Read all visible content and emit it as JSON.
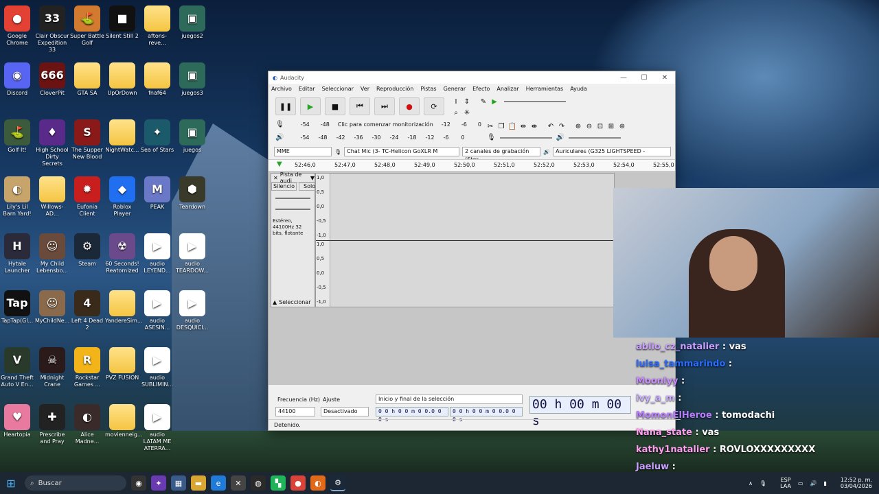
{
  "desktop": {
    "icons": [
      {
        "label": "Google Chrome",
        "color": "#e34133",
        "glyph": "●"
      },
      {
        "label": "Clair Obscur Expedition 33",
        "color": "#222",
        "glyph": "33"
      },
      {
        "label": "Super Battle Golf",
        "color": "#d27a2f",
        "glyph": "⛳"
      },
      {
        "label": "Silent Still 2",
        "color": "#111",
        "glyph": "■"
      },
      {
        "label": "aftons-reve...",
        "color": "folder",
        "glyph": ""
      },
      {
        "label": "juegos2",
        "color": "#2d6a5a",
        "glyph": "▣"
      },
      {
        "label": "Discord",
        "color": "#5865f2",
        "glyph": "◉"
      },
      {
        "label": "CloverPit",
        "color": "#6b1212",
        "glyph": "666"
      },
      {
        "label": "GTA SA",
        "color": "folder",
        "glyph": ""
      },
      {
        "label": "UpOrDown",
        "color": "folder",
        "glyph": ""
      },
      {
        "label": "fnaf64",
        "color": "folder",
        "glyph": ""
      },
      {
        "label": "juegos3",
        "color": "#2d6a5a",
        "glyph": "▣"
      },
      {
        "label": "Golf It!",
        "color": "#3c5a3c",
        "glyph": "⛳"
      },
      {
        "label": "High School Dirty Secrets",
        "color": "#5a2a8a",
        "glyph": "♦"
      },
      {
        "label": "The Supper New Blood",
        "color": "#8a1a1a",
        "glyph": "S"
      },
      {
        "label": "NightWatc...",
        "color": "folder",
        "glyph": ""
      },
      {
        "label": "Sea of Stars",
        "color": "#1a5a6a",
        "glyph": "✦"
      },
      {
        "label": "juegos",
        "color": "#2d6a5a",
        "glyph": "▣"
      },
      {
        "label": "Lily's Lil Barn Yard!",
        "color": "#c7a46a",
        "glyph": "◐"
      },
      {
        "label": "Willows-AD...",
        "color": "folder",
        "glyph": ""
      },
      {
        "label": "Eufonia Client",
        "color": "#c81e1e",
        "glyph": "✹"
      },
      {
        "label": "Roblox Player",
        "color": "#1f6ff0",
        "glyph": "◆"
      },
      {
        "label": "PEAK",
        "color": "#6a78c8",
        "glyph": "M"
      },
      {
        "label": "Teardown",
        "color": "#3a3a2a",
        "glyph": "⬢"
      },
      {
        "label": "Hytale Launcher",
        "color": "#2a2a3a",
        "glyph": "H"
      },
      {
        "label": "My Child Lebensbo...",
        "color": "#6a4a3a",
        "glyph": "☺"
      },
      {
        "label": "Steam",
        "color": "#1b2838",
        "glyph": "⚙"
      },
      {
        "label": "60 Seconds! Reatomized",
        "color": "#6a4a8a",
        "glyph": "☢"
      },
      {
        "label": "audio LEYEND...",
        "color": "media",
        "glyph": "▶"
      },
      {
        "label": "audio TEARDOW...",
        "color": "media",
        "glyph": "▶"
      },
      {
        "label": "TapTap(Gl...",
        "color": "#111",
        "glyph": "Tap"
      },
      {
        "label": "MyChildNe...",
        "color": "#8a6a4a",
        "glyph": "☺"
      },
      {
        "label": "Left 4 Dead 2",
        "color": "#3a2a1a",
        "glyph": "4"
      },
      {
        "label": "YandereSim...",
        "color": "folder",
        "glyph": ""
      },
      {
        "label": "audio ASESIN...",
        "color": "media",
        "glyph": "▶"
      },
      {
        "label": "audio DESQUICI...",
        "color": "media",
        "glyph": "▶"
      },
      {
        "label": "Grand Theft Auto V En...",
        "color": "#2a3a2a",
        "glyph": "V"
      },
      {
        "label": "Midnight Crane",
        "color": "#2a1a1a",
        "glyph": "☠"
      },
      {
        "label": "Rockstar Games ...",
        "color": "#f2b418",
        "glyph": "R"
      },
      {
        "label": "PVZ FUSION",
        "color": "folder",
        "glyph": ""
      },
      {
        "label": "audio SUBLIMIN...",
        "color": "media",
        "glyph": "▶"
      },
      {
        "label": "",
        "color": "none",
        "glyph": ""
      },
      {
        "label": "Heartopia",
        "color": "#e87aa0",
        "glyph": "♥"
      },
      {
        "label": "Prescribe and Pray",
        "color": "#222",
        "glyph": "✚"
      },
      {
        "label": "Alice Madne...",
        "color": "#3a2a2a",
        "glyph": "◐"
      },
      {
        "label": "movienneig...",
        "color": "folder",
        "glyph": ""
      },
      {
        "label": "audio LATAM ME ATERRA...",
        "color": "media",
        "glyph": "▶"
      },
      {
        "label": "",
        "color": "none",
        "glyph": ""
      }
    ]
  },
  "audacity": {
    "title": "Audacity",
    "menu": [
      "Archivo",
      "Editar",
      "Seleccionar",
      "Ver",
      "Reproducción",
      "Pistas",
      "Generar",
      "Efecto",
      "Analizar",
      "Herramientas",
      "Ayuda"
    ],
    "meter_rec_label": "Clic para comenzar monitorización",
    "meter_ticks_rec": [
      "-54",
      "-48",
      "-12",
      "-6",
      "0"
    ],
    "meter_ticks_play": [
      "-54",
      "-48",
      "-42",
      "-36",
      "-30",
      "-24",
      "-18",
      "-12",
      "-6",
      "0"
    ],
    "host": "MME",
    "rec_device": "Chat Mic (3- TC-Helicon GoXLR M",
    "channels": "2 canales de grabación (Ster",
    "play_device": "Auriculares (G325 LIGHTSPEED -",
    "ruler_times": [
      "52:46,0",
      "52:47,0",
      "52:48,0",
      "52:49,0",
      "52:50,0",
      "52:51,0",
      "52:52,0",
      "52:53,0",
      "52:54,0",
      "52:55,0"
    ],
    "track": {
      "name": "Pista de audi",
      "mute": "Silencio",
      "solo": "Solo",
      "info": "Estéreo, 44100Hz 32 bits, flotante",
      "select": "Seleccionar",
      "scale": [
        "1,0",
        "0,5",
        "0,0",
        "-0,5",
        "-1,0"
      ]
    },
    "bottom": {
      "rate_label": "Frecuencia (Hz)",
      "rate_value": "44100",
      "snap_label": "Ajuste",
      "snap_value": "Desactivado",
      "sel_label": "Inicio y final de la selección",
      "sel_start": "0 0 h 0 0 m 0 0.0 0 0 s",
      "sel_end": "0 0 h 0 0 m 0 0.0 0 0 s",
      "time": "00 h 00 m 00 s"
    },
    "status": "Detenido."
  },
  "chat": [
    {
      "user": "ablio_cz_natalier",
      "msg": "vas",
      "color": "#c9a0ff"
    },
    {
      "user": "luisa_tammarindo",
      "msg": "",
      "color": "#2a6cff"
    },
    {
      "user": "Moonlyy",
      "msg": "",
      "color": "#c98cff"
    },
    {
      "user": "ivy_a_m",
      "msg": "",
      "color": "#c9b0ff"
    },
    {
      "user": "MomonElHeroe",
      "msg": "tomodachi",
      "color": "#b87cff"
    },
    {
      "user": "Nana_state",
      "msg": "vas",
      "color": "#ff9ef0"
    },
    {
      "user": "kathy1natalier",
      "msg": "ROVLOXXXXXXXXX",
      "color": "#ff9ef0"
    },
    {
      "user": "Jaeluw",
      "msg": "",
      "color": "#c9a0ff"
    }
  ],
  "taskbar": {
    "search": "Buscar",
    "lang": "ESP",
    "layout": "LAA",
    "time": "12:52 p. m.",
    "date": "03/04/2026"
  }
}
